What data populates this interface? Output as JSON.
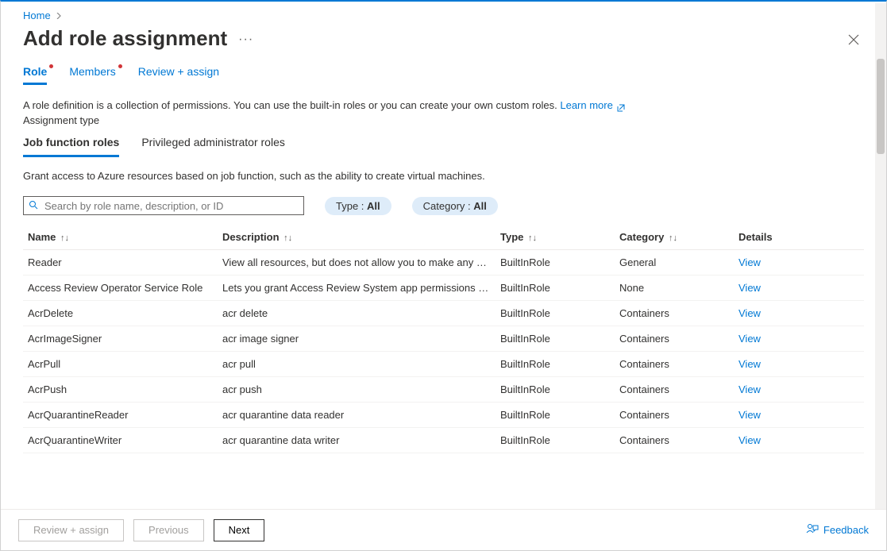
{
  "breadcrumb": {
    "home": "Home"
  },
  "header": {
    "title": "Add role assignment",
    "more": "···"
  },
  "wizard_tabs": {
    "role": "Role",
    "members": "Members",
    "review": "Review + assign"
  },
  "intro": {
    "text": "A role definition is a collection of permissions. You can use the built-in roles or you can create your own custom roles. ",
    "learn_more": "Learn more",
    "assignment_type": "Assignment type"
  },
  "inner_tabs": {
    "job": "Job function roles",
    "priv": "Privileged administrator roles"
  },
  "grant_text": "Grant access to Azure resources based on job function, such as the ability to create virtual machines.",
  "search": {
    "placeholder": "Search by role name, description, or ID"
  },
  "filters": {
    "type_label": "Type : ",
    "type_value": "All",
    "category_label": "Category : ",
    "category_value": "All"
  },
  "columns": {
    "name": "Name",
    "description": "Description",
    "type": "Type",
    "category": "Category",
    "details": "Details"
  },
  "view_label": "View",
  "rows": [
    {
      "name": "Reader",
      "description": "View all resources, but does not allow you to make any ch…",
      "type": "BuiltInRole",
      "category": "General"
    },
    {
      "name": "Access Review Operator Service Role",
      "description": "Lets you grant Access Review System app permissions to …",
      "type": "BuiltInRole",
      "category": "None"
    },
    {
      "name": "AcrDelete",
      "description": "acr delete",
      "type": "BuiltInRole",
      "category": "Containers"
    },
    {
      "name": "AcrImageSigner",
      "description": "acr image signer",
      "type": "BuiltInRole",
      "category": "Containers"
    },
    {
      "name": "AcrPull",
      "description": "acr pull",
      "type": "BuiltInRole",
      "category": "Containers"
    },
    {
      "name": "AcrPush",
      "description": "acr push",
      "type": "BuiltInRole",
      "category": "Containers"
    },
    {
      "name": "AcrQuarantineReader",
      "description": "acr quarantine data reader",
      "type": "BuiltInRole",
      "category": "Containers"
    },
    {
      "name": "AcrQuarantineWriter",
      "description": "acr quarantine data writer",
      "type": "BuiltInRole",
      "category": "Containers"
    }
  ],
  "footer": {
    "review": "Review + assign",
    "previous": "Previous",
    "next": "Next",
    "feedback": "Feedback"
  }
}
